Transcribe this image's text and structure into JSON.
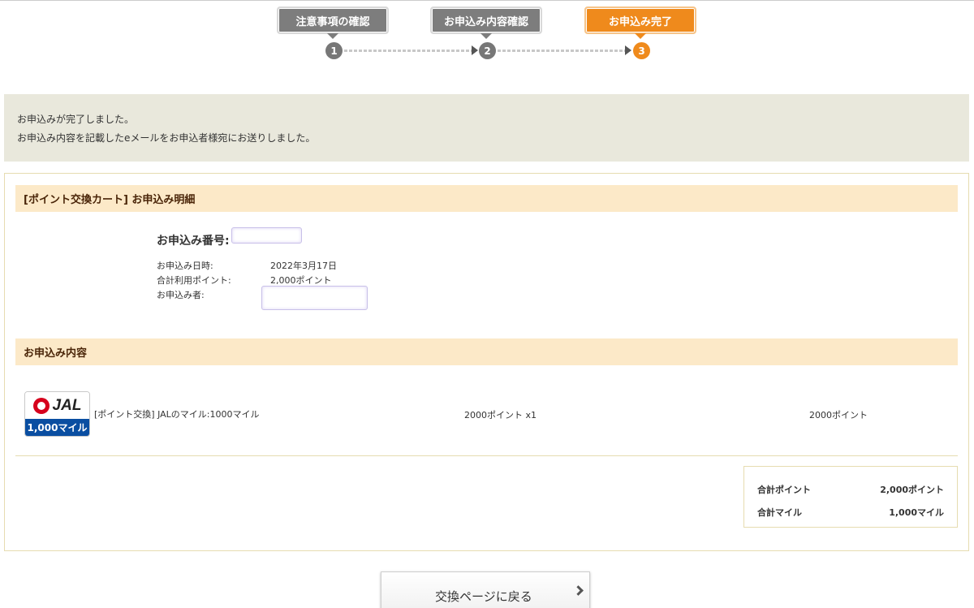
{
  "steps": [
    {
      "label": "注意事項の確認",
      "number": "1",
      "active": false
    },
    {
      "label": "お申込み内容確認",
      "number": "2",
      "active": false
    },
    {
      "label": "お申込み完了",
      "number": "3",
      "active": true
    }
  ],
  "message": {
    "line1": "お申込みが完了しました。",
    "line2": "お申込み内容を記載したeメールをお申込者様宛にお送りしました。"
  },
  "detail": {
    "header": "[ポイント交換カート] お申込み明細",
    "order_number_label": "お申込み番号:",
    "date_label": "お申込み日時:",
    "date_value": "2022年3月17日",
    "points_label": "合計利用ポイント:",
    "points_value": "2,000ポイント",
    "applicant_label": "お申込み者:"
  },
  "contents": {
    "header": "お申込み内容",
    "item": {
      "logo_text": "JAL",
      "logo_sub": "1,000マイル",
      "name": "[ポイント交換] JALのマイル:1000マイル",
      "qty": "2000ポイント x1",
      "total": "2000ポイント"
    }
  },
  "summary": {
    "points_label": "合計ポイント",
    "points_value": "2,000ポイント",
    "miles_label": "合計マイル",
    "miles_value": "1,000マイル"
  },
  "back_button": {
    "label": "交換ページに戻る"
  },
  "colors": {
    "active_step": "#ef8a1c",
    "inactive_step": "#7d7d7d",
    "section_header": "#fce9c8",
    "jal_red": "#d6001c",
    "jal_blue": "#0a4ea1"
  }
}
